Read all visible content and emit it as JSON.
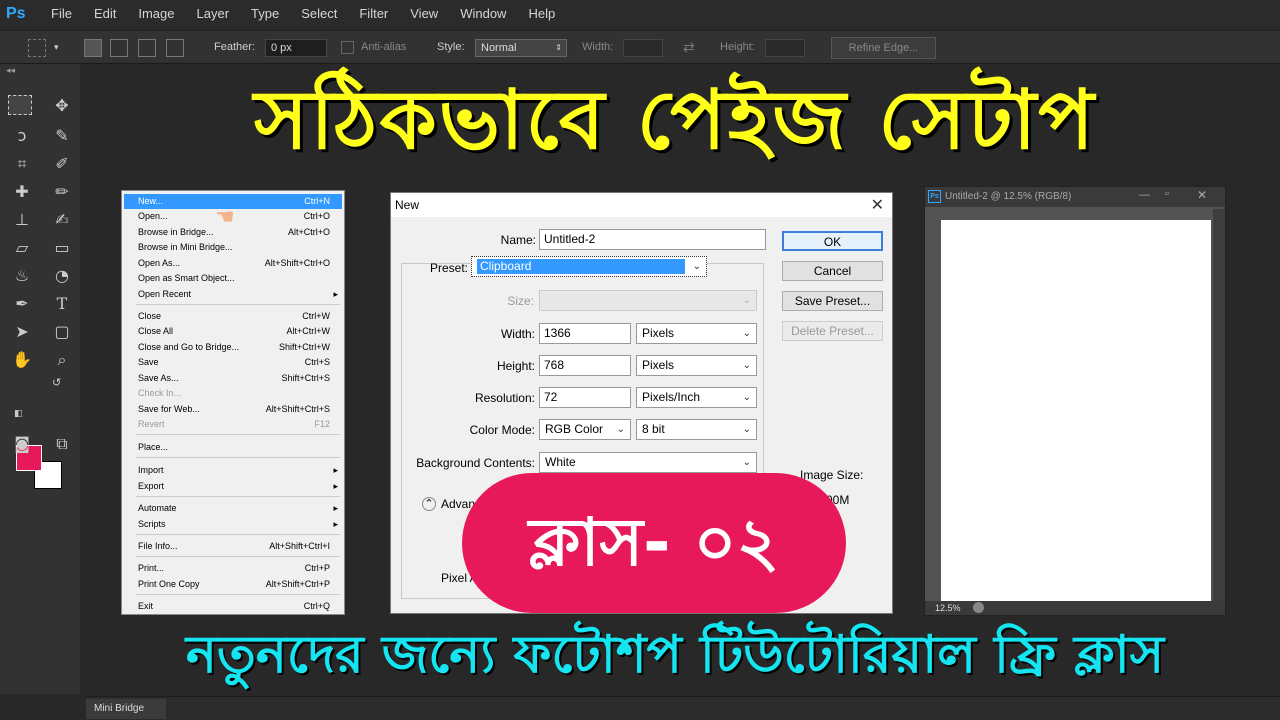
{
  "app": {
    "logo": "Ps",
    "menu": [
      "File",
      "Edit",
      "Image",
      "Layer",
      "Type",
      "Select",
      "Filter",
      "View",
      "Window",
      "Help"
    ]
  },
  "options": {
    "feather_label": "Feather:",
    "feather_value": "0 px",
    "antialias_label": "Anti-alias",
    "style_label": "Style:",
    "style_value": "Normal",
    "width_label": "Width:",
    "height_label": "Height:",
    "refine_edge_label": "Refine Edge..."
  },
  "headline": "সঠিকভাবে পেইজ সেটাপ",
  "footer_text": "নতুনদের জন্যে ফটোশপ টিউটোরিয়াল ফ্রি ক্লাস",
  "class_badge": "ক্লাস- ০২",
  "file_menu": {
    "items": [
      {
        "label": "New...",
        "shortcut": "Ctrl+N"
      },
      {
        "label": "Open...",
        "shortcut": "Ctrl+O"
      },
      {
        "label": "Browse in Bridge...",
        "shortcut": "Alt+Ctrl+O"
      },
      {
        "label": "Browse in Mini Bridge...",
        "shortcut": ""
      },
      {
        "label": "Open As...",
        "shortcut": "Alt+Shift+Ctrl+O"
      },
      {
        "label": "Open as Smart Object...",
        "shortcut": ""
      },
      {
        "label": "Open Recent",
        "shortcut": ""
      },
      {
        "label": "Close",
        "shortcut": "Ctrl+W"
      },
      {
        "label": "Close All",
        "shortcut": "Alt+Ctrl+W"
      },
      {
        "label": "Close and Go to Bridge...",
        "shortcut": "Shift+Ctrl+W"
      },
      {
        "label": "Save",
        "shortcut": "Ctrl+S"
      },
      {
        "label": "Save As...",
        "shortcut": "Shift+Ctrl+S"
      },
      {
        "label": "Check In...",
        "shortcut": ""
      },
      {
        "label": "Save for Web...",
        "shortcut": "Alt+Shift+Ctrl+S"
      },
      {
        "label": "Revert",
        "shortcut": "F12"
      },
      {
        "label": "Place...",
        "shortcut": ""
      },
      {
        "label": "Import",
        "shortcut": ""
      },
      {
        "label": "Export",
        "shortcut": ""
      },
      {
        "label": "Automate",
        "shortcut": ""
      },
      {
        "label": "Scripts",
        "shortcut": ""
      },
      {
        "label": "File Info...",
        "shortcut": "Alt+Shift+Ctrl+I"
      },
      {
        "label": "Print...",
        "shortcut": "Ctrl+P"
      },
      {
        "label": "Print One Copy",
        "shortcut": "Alt+Shift+Ctrl+P"
      },
      {
        "label": "Exit",
        "shortcut": "Ctrl+Q"
      }
    ]
  },
  "new_dialog": {
    "title": "New",
    "name_label": "Name:",
    "name_value": "Untitled-2",
    "preset_label": "Preset:",
    "preset_value": "Clipboard",
    "size_label": "Size:",
    "width_label": "Width:",
    "width_value": "1366",
    "width_unit": "Pixels",
    "height_label": "Height:",
    "height_value": "768",
    "height_unit": "Pixels",
    "resolution_label": "Resolution:",
    "resolution_value": "72",
    "resolution_unit": "Pixels/Inch",
    "color_mode_label": "Color Mode:",
    "color_mode_value": "RGB Color",
    "bit_depth_value": "8 bit",
    "background_label": "Background Contents:",
    "background_value": "White",
    "advanced_label": "Advanced",
    "pixel_aspect_label": "Pixel Aspe",
    "ok_label": "OK",
    "cancel_label": "Cancel",
    "save_preset_label": "Save Preset...",
    "delete_preset_label": "Delete Preset...",
    "image_size_label": "Image Size:",
    "image_size_value": "3.00M"
  },
  "document": {
    "tab_title": "Untitled-2 @ 12.5% (RGB/8)",
    "zoom": "12.5%"
  },
  "bottom_panel": {
    "tab_label": "Mini Bridge"
  },
  "colors": {
    "foreground": "#e8195a",
    "background": "#ffffff",
    "headline": "#ffff1a",
    "footer": "#14e5f0",
    "badge": "#e8195a"
  }
}
